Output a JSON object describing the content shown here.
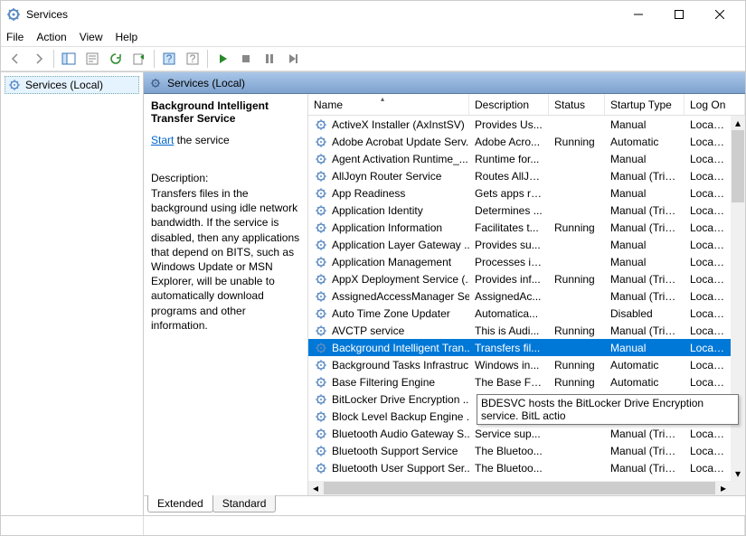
{
  "window": {
    "title": "Services"
  },
  "menu": {
    "file": "File",
    "action": "Action",
    "view": "View",
    "help": "Help"
  },
  "left": {
    "root": "Services (Local)"
  },
  "right": {
    "header": "Services (Local)",
    "detail": {
      "title": "Background Intelligent Transfer Service",
      "start_link": "Start",
      "start_suffix": " the service",
      "desc_label": "Description:",
      "desc_text": "Transfers files in the background using idle network bandwidth. If the service is disabled, then any applications that depend on BITS, such as Windows Update or MSN Explorer, will be unable to automatically download programs and other information."
    },
    "columns": {
      "name": "Name",
      "description": "Description",
      "status": "Status",
      "startup": "Startup Type",
      "logon": "Log On"
    },
    "tooltip": "BDESVC hosts the BitLocker Drive Encryption service. BitL\nactio",
    "services": [
      {
        "name": "ActiveX Installer (AxInstSV)",
        "desc": "Provides Us...",
        "status": "",
        "startup": "Manual",
        "logon": "Local Sy"
      },
      {
        "name": "Adobe Acrobat Update Serv...",
        "desc": "Adobe Acro...",
        "status": "Running",
        "startup": "Automatic",
        "logon": "Local Sy"
      },
      {
        "name": "Agent Activation Runtime_...",
        "desc": "Runtime for...",
        "status": "",
        "startup": "Manual",
        "logon": "Local Sy"
      },
      {
        "name": "AllJoyn Router Service",
        "desc": "Routes AllJo...",
        "status": "",
        "startup": "Manual (Trig...",
        "logon": "Local Se"
      },
      {
        "name": "App Readiness",
        "desc": "Gets apps re...",
        "status": "",
        "startup": "Manual",
        "logon": "Local Sy"
      },
      {
        "name": "Application Identity",
        "desc": "Determines ...",
        "status": "",
        "startup": "Manual (Trig...",
        "logon": "Local Se"
      },
      {
        "name": "Application Information",
        "desc": "Facilitates t...",
        "status": "Running",
        "startup": "Manual (Trig...",
        "logon": "Local Sy"
      },
      {
        "name": "Application Layer Gateway ...",
        "desc": "Provides su...",
        "status": "",
        "startup": "Manual",
        "logon": "Local Se"
      },
      {
        "name": "Application Management",
        "desc": "Processes in...",
        "status": "",
        "startup": "Manual",
        "logon": "Local Sy"
      },
      {
        "name": "AppX Deployment Service (...",
        "desc": "Provides inf...",
        "status": "Running",
        "startup": "Manual (Trig...",
        "logon": "Local Sy"
      },
      {
        "name": "AssignedAccessManager Se...",
        "desc": "AssignedAc...",
        "status": "",
        "startup": "Manual (Trig...",
        "logon": "Local Sy"
      },
      {
        "name": "Auto Time Zone Updater",
        "desc": "Automatica...",
        "status": "",
        "startup": "Disabled",
        "logon": "Local Se"
      },
      {
        "name": "AVCTP service",
        "desc": "This is Audi...",
        "status": "Running",
        "startup": "Manual (Trig...",
        "logon": "Local Se"
      },
      {
        "name": "Background Intelligent Tran...",
        "desc": "Transfers fil...",
        "status": "",
        "startup": "Manual",
        "logon": "Local Sy",
        "selected": true
      },
      {
        "name": "Background Tasks Infrastruc...",
        "desc": "Windows in...",
        "status": "Running",
        "startup": "Automatic",
        "logon": "Local Sy"
      },
      {
        "name": "Base Filtering Engine",
        "desc": "The Base Fil...",
        "status": "Running",
        "startup": "Automatic",
        "logon": "Local Se"
      },
      {
        "name": "BitLocker Drive Encryption ...",
        "desc": "",
        "status": "",
        "startup": "",
        "logon": ""
      },
      {
        "name": "Block Level Backup Engine ...",
        "desc": "",
        "status": "",
        "startup": "",
        "logon": ""
      },
      {
        "name": "Bluetooth Audio Gateway S...",
        "desc": "Service sup...",
        "status": "",
        "startup": "Manual (Trig...",
        "logon": "Local Se"
      },
      {
        "name": "Bluetooth Support Service",
        "desc": "The Bluetoo...",
        "status": "",
        "startup": "Manual (Trig...",
        "logon": "Local Se"
      },
      {
        "name": "Bluetooth User Support Ser...",
        "desc": "The Bluetoo...",
        "status": "",
        "startup": "Manual (Trig...",
        "logon": "Local Sy"
      }
    ]
  },
  "tabs": {
    "extended": "Extended",
    "standard": "Standard"
  }
}
